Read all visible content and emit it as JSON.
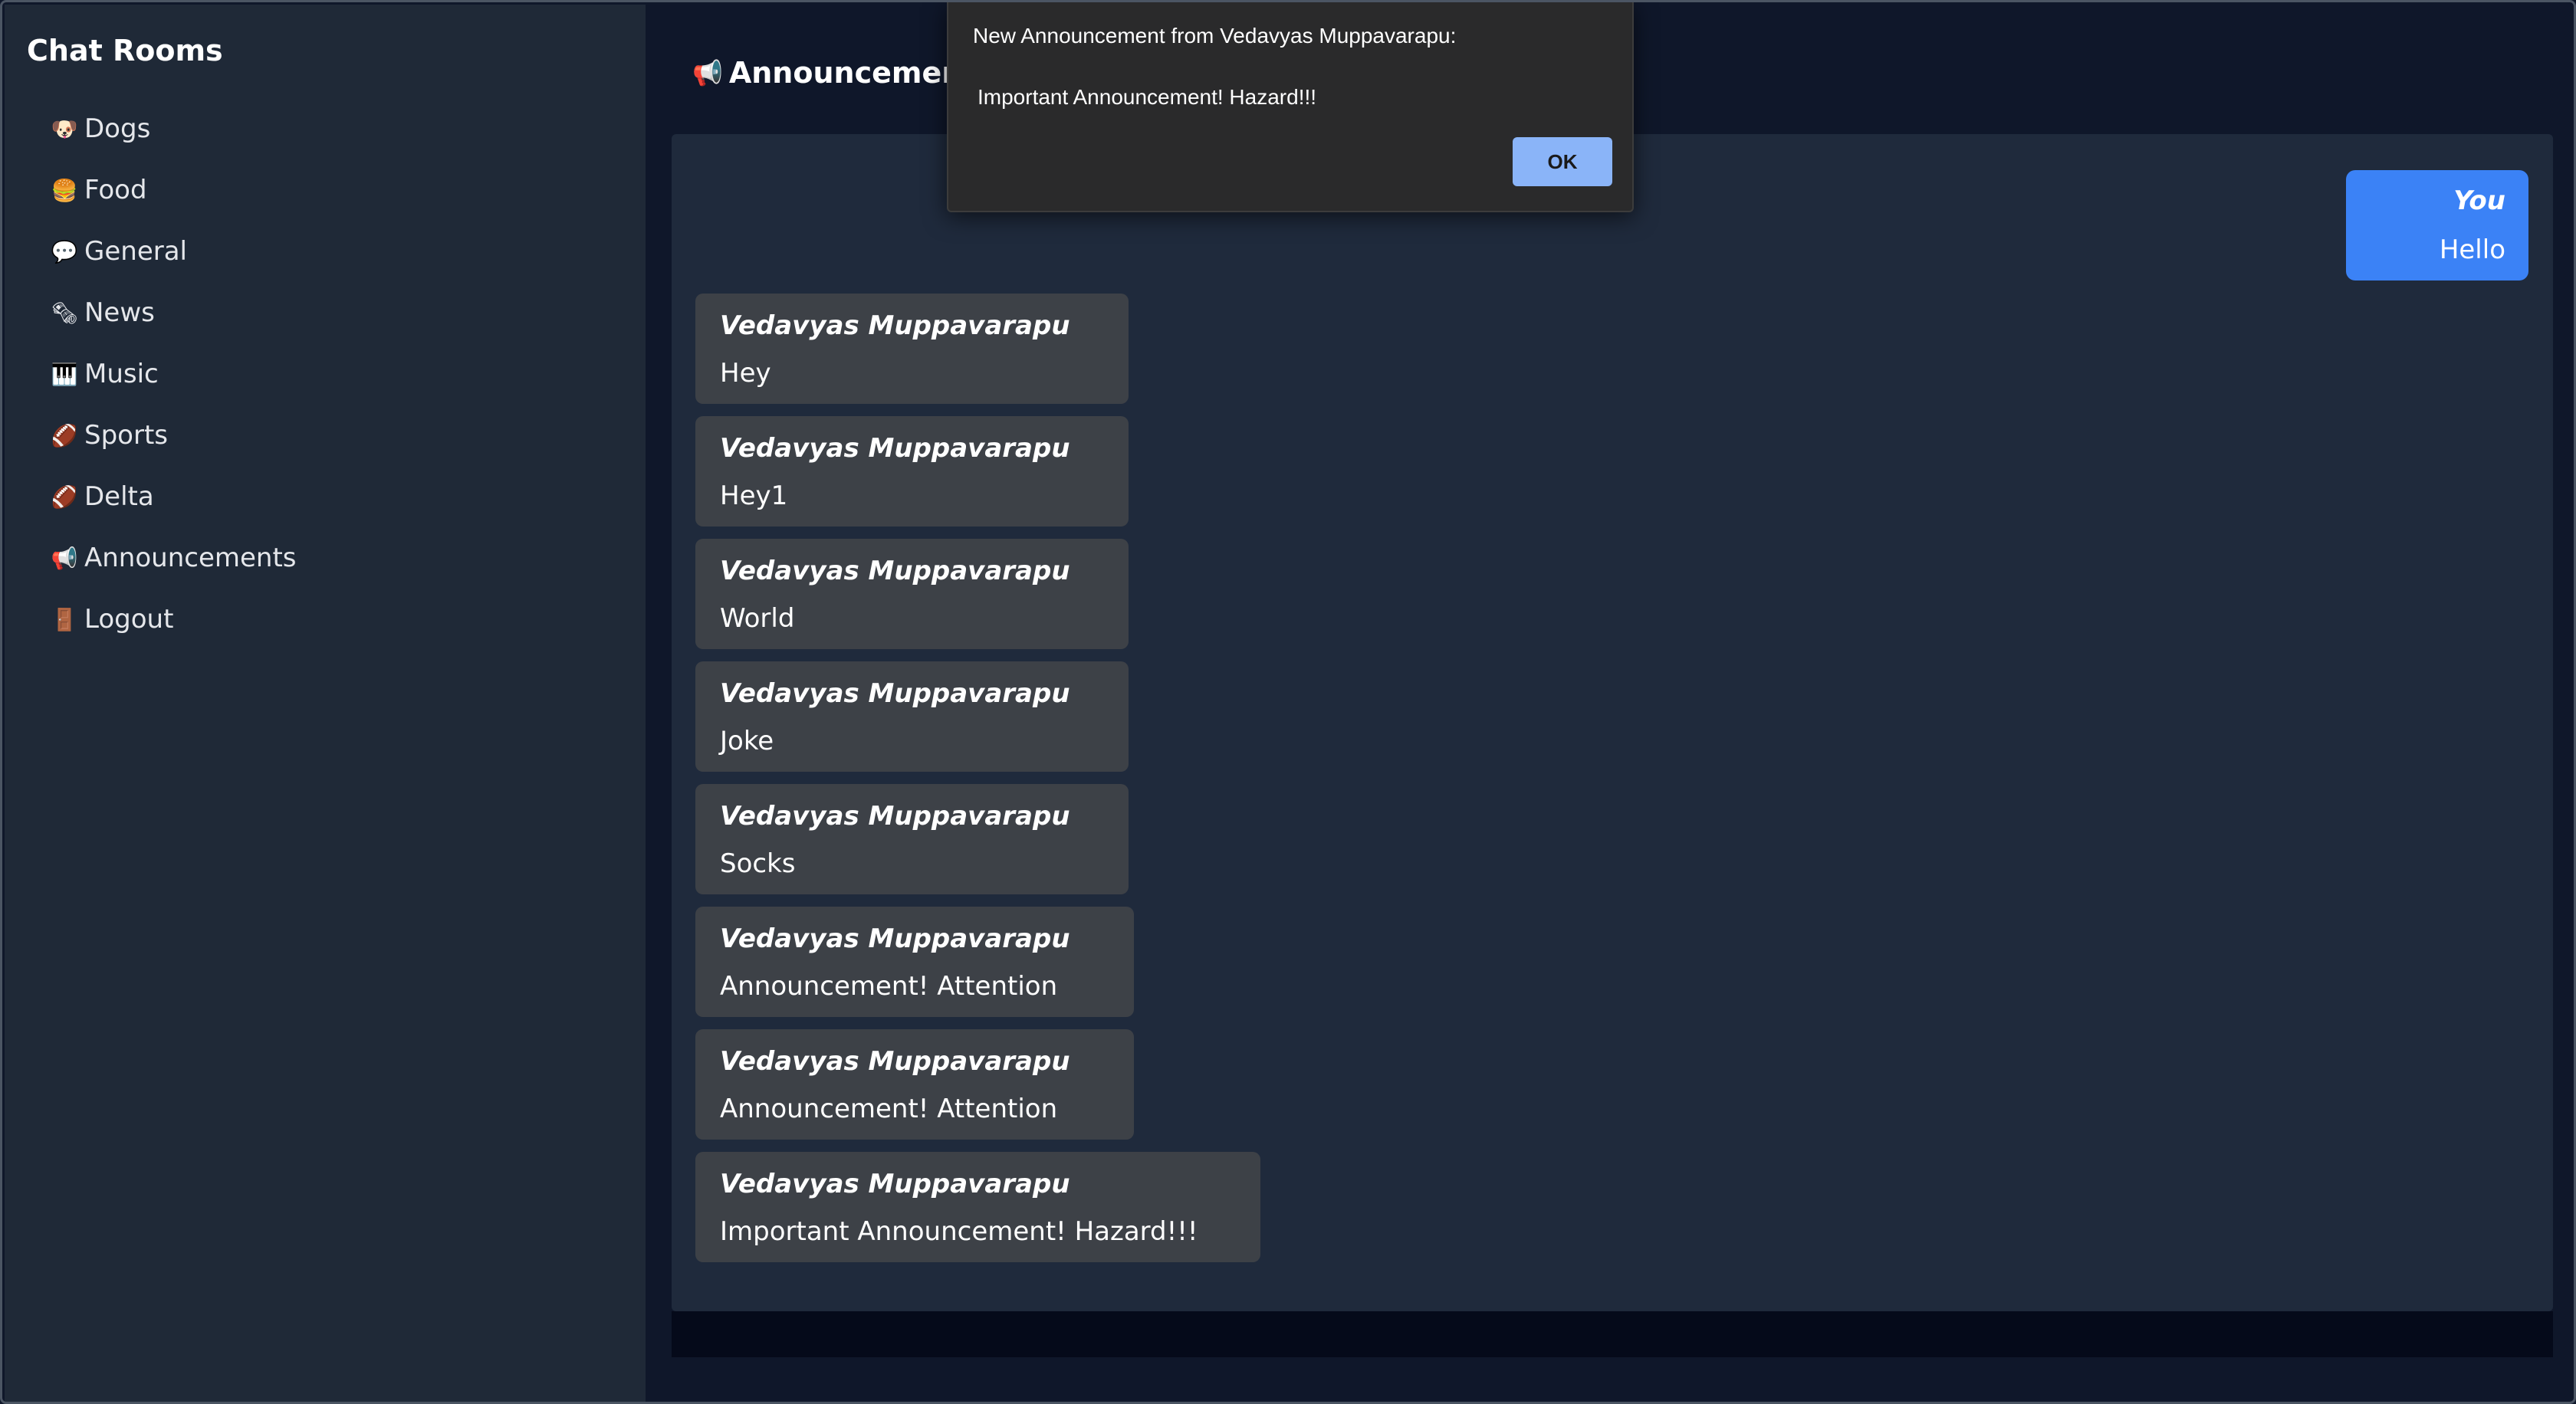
{
  "sidebar": {
    "title": "Chat Rooms",
    "rooms": [
      {
        "icon": "🐶",
        "icon_name": "dog-icon",
        "label": "Dogs"
      },
      {
        "icon": "🍔",
        "icon_name": "burger-icon",
        "label": "Food"
      },
      {
        "icon": "💬",
        "icon_name": "speech-bubble-icon",
        "label": "General"
      },
      {
        "icon": "🗞",
        "icon_name": "newspaper-icon",
        "label": "News"
      },
      {
        "icon": "🎹",
        "icon_name": "piano-icon",
        "label": "Music"
      },
      {
        "icon": "🏈",
        "icon_name": "football-icon",
        "label": "Sports"
      },
      {
        "icon": "🏈",
        "icon_name": "football-icon",
        "label": "Delta"
      },
      {
        "icon": "📢",
        "icon_name": "megaphone-icon",
        "label": "Announcements"
      },
      {
        "icon": "🚪",
        "icon_name": "door-icon",
        "label": "Logout"
      }
    ]
  },
  "header": {
    "icon": "📢",
    "icon_name": "megaphone-icon",
    "title": "Announcements"
  },
  "own_message": {
    "sender": "You",
    "text": "Hello"
  },
  "messages": [
    {
      "sender": "Vedavyas Muppavarapu",
      "text": "Hey"
    },
    {
      "sender": "Vedavyas Muppavarapu",
      "text": "Hey1"
    },
    {
      "sender": "Vedavyas Muppavarapu",
      "text": "World"
    },
    {
      "sender": "Vedavyas Muppavarapu",
      "text": "Joke"
    },
    {
      "sender": "Vedavyas Muppavarapu",
      "text": "Socks"
    },
    {
      "sender": "Vedavyas Muppavarapu",
      "text": "Announcement! Attention"
    },
    {
      "sender": "Vedavyas Muppavarapu",
      "text": "Announcement! Attention"
    },
    {
      "sender": "Vedavyas Muppavarapu",
      "text": "Important Announcement! Hazard!!!"
    }
  ],
  "dialog": {
    "title": "New Announcement from Vedavyas Muppavarapu:",
    "message": "Important Announcement! Hazard!!!",
    "ok_label": "OK"
  },
  "colors": {
    "background": "#0f172a",
    "sidebar": "#1f2937",
    "chat_panel": "#1f2a3c",
    "message_bubble": "#3d4147",
    "own_bubble": "#3b82f6",
    "dialog_button": "#8ab4f8"
  }
}
